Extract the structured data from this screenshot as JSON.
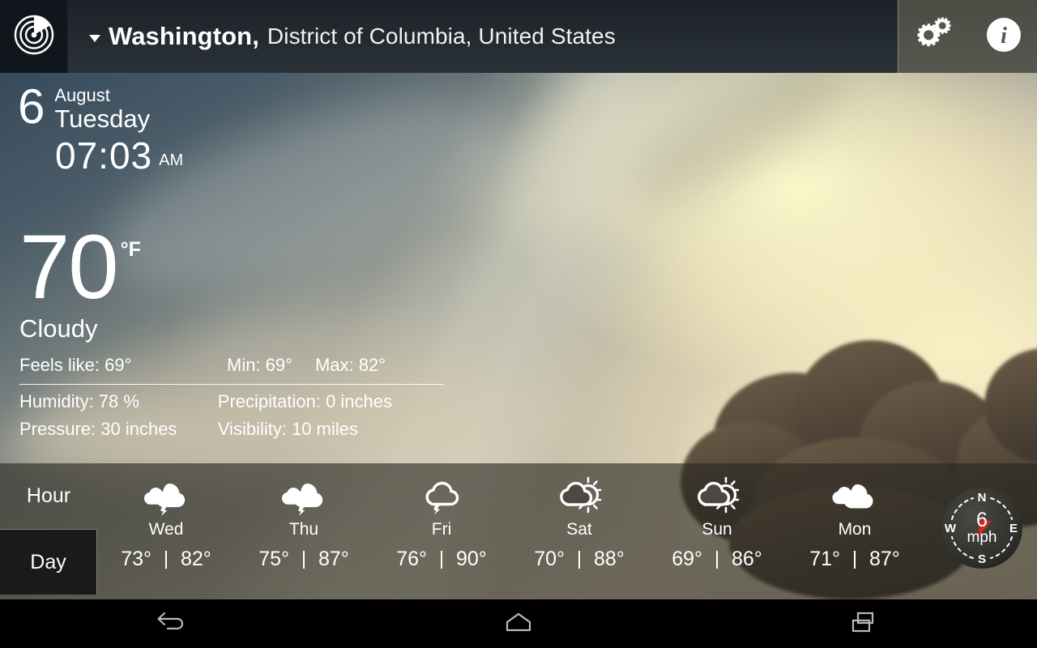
{
  "header": {
    "logo_icon": "radar-logo-icon",
    "dropdown_icon": "chevron-down-icon",
    "city": "Washington,",
    "region": "District of Columbia, United States",
    "settings_icon": "gear-icon",
    "info_icon": "info-icon"
  },
  "current": {
    "day_number": "6",
    "month": "August",
    "weekday": "Tuesday",
    "time": "07:03",
    "meridiem": "AM",
    "temperature": "70",
    "unit": "°F",
    "condition": "Cloudy",
    "feels_like_label": "Feels like: 69°",
    "min_label": "Min: 69°",
    "max_label": "Max: 82°",
    "humidity_label": "Humidity: 78 %",
    "precipitation_label": "Precipitation: 0 inches",
    "pressure_label": "Pressure: 30 inches",
    "visibility_label": "Visibility: 10 miles"
  },
  "forecast": {
    "tabs": [
      {
        "label": "Hour",
        "active": false
      },
      {
        "label": "Day",
        "active": true
      }
    ],
    "days": [
      {
        "name": "Wed",
        "icon": "cloud-sun-lightning-icon",
        "low": "73°",
        "high": "82°"
      },
      {
        "name": "Thu",
        "icon": "cloud-sun-lightning-icon",
        "low": "75°",
        "high": "87°"
      },
      {
        "name": "Fri",
        "icon": "cloud-lightning-icon",
        "low": "76°",
        "high": "90°"
      },
      {
        "name": "Sat",
        "icon": "sun-behind-cloud-icon",
        "low": "70°",
        "high": "88°"
      },
      {
        "name": "Sun",
        "icon": "sun-behind-cloud-icon",
        "low": "69°",
        "high": "86°"
      },
      {
        "name": "Mon",
        "icon": "cloud-icon",
        "low": "71°",
        "high": "87°"
      }
    ]
  },
  "wind": {
    "speed": "6",
    "unit": "mph",
    "north": "N",
    "east": "E",
    "south": "S",
    "west": "W",
    "needle_direction_deg": 205,
    "needle_color": "#d8281e"
  },
  "navbar": {
    "back_icon": "back-arrow-icon",
    "home_icon": "home-icon",
    "recents_icon": "recent-apps-icon"
  },
  "colors": {
    "topbar": "#232a30",
    "strip_overlay": "rgba(40,38,32,0.62)",
    "active_tab": "#1a1a1a",
    "text": "#ffffff"
  }
}
